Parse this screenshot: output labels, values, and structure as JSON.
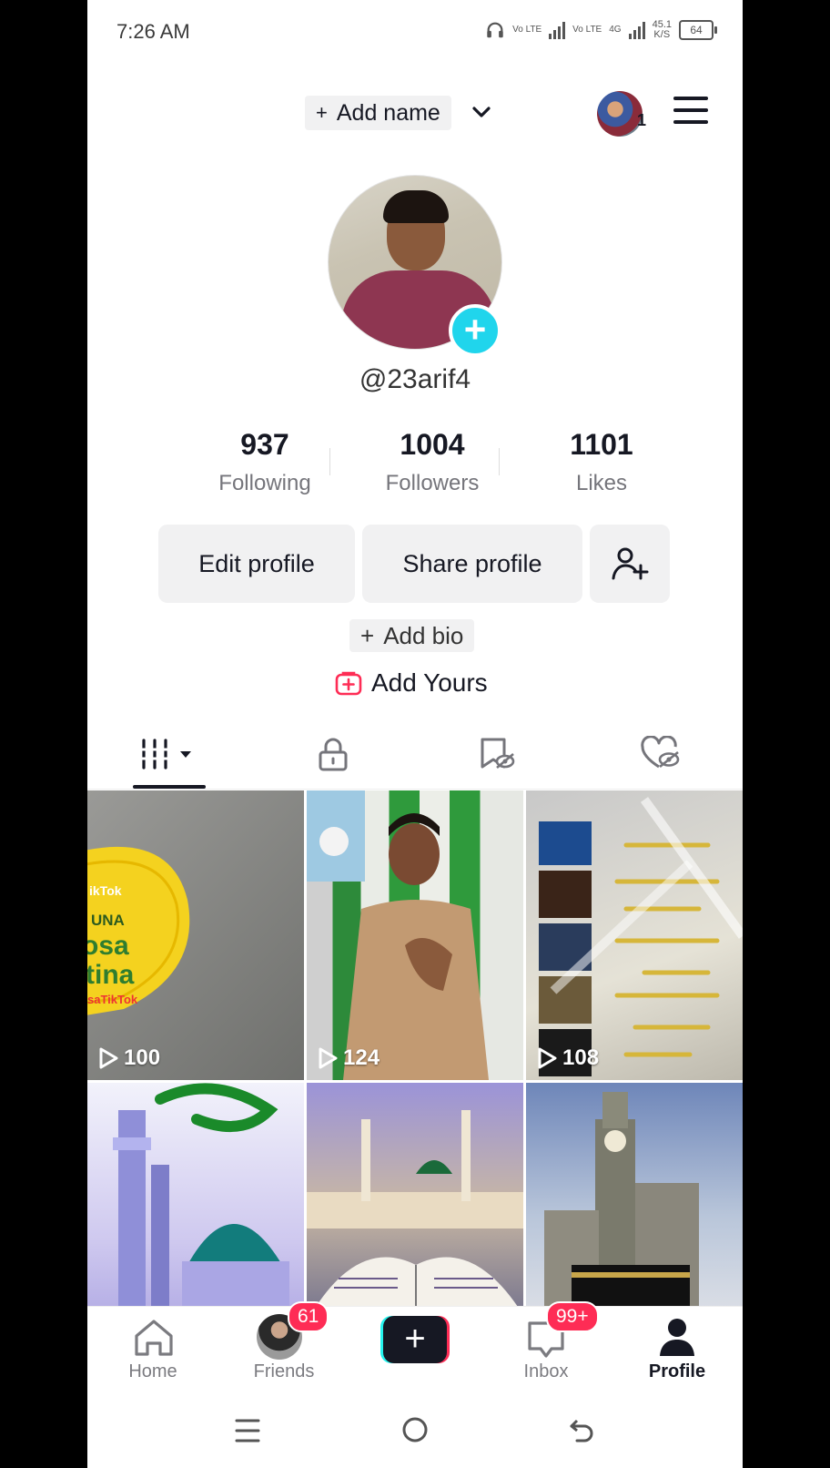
{
  "status_bar": {
    "time": "7:26 AM",
    "volte1": "Vo LTE",
    "volte2": "Vo LTE",
    "network": "4G",
    "speed_value": "45.1",
    "speed_unit": "K/S",
    "battery": "64"
  },
  "header": {
    "add_name_plus": "+",
    "add_name_label": "Add name",
    "account_count": "1"
  },
  "profile": {
    "username": "@23arif4",
    "stats": [
      {
        "value": "937",
        "label": "Following"
      },
      {
        "value": "1004",
        "label": "Followers"
      },
      {
        "value": "1101",
        "label": "Likes"
      }
    ],
    "edit_profile": "Edit profile",
    "share_profile": "Share profile",
    "add_bio_plus": "+",
    "add_bio": "Add bio",
    "add_yours": "Add Yours"
  },
  "tabs": [
    "videos-grid-icon",
    "lock-icon",
    "saved-hidden-icon",
    "liked-hidden-icon"
  ],
  "videos": [
    {
      "views": "100",
      "theme": "yellow-sticker"
    },
    {
      "views": "124",
      "theme": "prayer"
    },
    {
      "views": "108",
      "theme": "calendar"
    },
    {
      "views": "",
      "theme": "mosque-green-dome"
    },
    {
      "views": "",
      "theme": "quran-mosque"
    },
    {
      "views": "",
      "theme": "clock-tower"
    }
  ],
  "nav": {
    "home": "Home",
    "friends": "Friends",
    "friends_badge": "61",
    "inbox": "Inbox",
    "inbox_badge": "99+",
    "profile": "Profile"
  },
  "colors": {
    "accent": "#fe2c55",
    "teal": "#20d5ec"
  }
}
